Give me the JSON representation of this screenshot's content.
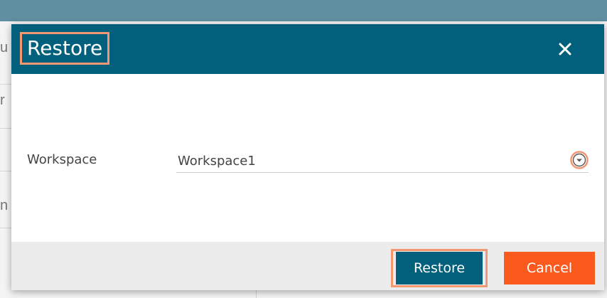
{
  "background": {
    "fragments": [
      "u",
      "r",
      "n"
    ]
  },
  "dialog": {
    "title": "Restore",
    "close_label": "✕",
    "field": {
      "label": "Workspace",
      "value": "Workspace1"
    },
    "buttons": {
      "restore_label": "Restore",
      "cancel_label": "Cancel"
    }
  },
  "colors": {
    "header": "#02607c",
    "highlight": "#f39672",
    "restore_button": "#02607c",
    "cancel_button": "#fb5a1f",
    "footer": "#ececec"
  },
  "icons": {
    "close": "close-icon",
    "dropdown": "chevron-down-circle-icon"
  }
}
